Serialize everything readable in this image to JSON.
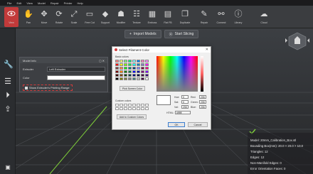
{
  "menubar": [
    "File",
    "Edit",
    "View",
    "Model",
    "Repair",
    "Printer",
    "Help"
  ],
  "toolbar": [
    {
      "label": "View",
      "icon": "eye-icon",
      "active": true
    },
    {
      "label": "Pan",
      "icon": "hand-icon"
    },
    {
      "label": "Move",
      "icon": "move-icon"
    },
    {
      "label": "Rotate",
      "icon": "rotate-icon"
    },
    {
      "label": "Scale",
      "icon": "scale-icon"
    },
    {
      "label": "Free Cut",
      "icon": "cut-icon"
    },
    {
      "label": "Support",
      "icon": "support-icon"
    },
    {
      "label": "Modifier",
      "icon": "modifier-icon"
    },
    {
      "label": "Texture",
      "icon": "texture-icon"
    },
    {
      "label": "Emboss",
      "icon": "emboss-icon"
    },
    {
      "label": "Flat FB",
      "icon": "flat-icon"
    },
    {
      "label": "Duplicate",
      "icon": "duplicate-icon"
    },
    {
      "label": "Repair",
      "icon": "repair-icon"
    },
    {
      "label": "Connect",
      "icon": "connect-icon"
    },
    {
      "label": "Library",
      "icon": "library-icon"
    },
    {
      "label": "Cloud",
      "icon": "cloud-icon"
    }
  ],
  "actions": {
    "import": "Import Models",
    "slice": "Start Slicing"
  },
  "model_info": {
    "title": "Model Info",
    "extruder_label": "Extruder",
    "extruder_value": "Left Extruder",
    "color_label": "Color",
    "color_value": "#ffffff",
    "printing_range_label": "Show Extruder's Printing Range"
  },
  "color_dialog": {
    "title": "Select Filament Color",
    "basic_colors_label": "Basic colors",
    "pick_screen_label": "Pick Screen Color",
    "custom_colors_label": "Custom colors",
    "add_custom_label": "Add to Custom Colors",
    "hue_label": "Hue:",
    "hue_value": "0",
    "sat_label": "Sat:",
    "sat_value": "0",
    "val_label": "Val:",
    "val_value": "255",
    "red_label": "Red:",
    "red_value": "255",
    "green_label": "Green:",
    "green_value": "255",
    "blue_label": "Blue:",
    "blue_value": "255",
    "html_label": "HTML:",
    "html_value": "#ffffff",
    "ok_label": "OK",
    "cancel_label": "Cancel",
    "basic_colors": [
      "#ff8080",
      "#ffff80",
      "#80ff80",
      "#00ff80",
      "#80ffff",
      "#0080ff",
      "#ff80c0",
      "#ff80ff",
      "#ff0000",
      "#ffff00",
      "#80ff00",
      "#00ff40",
      "#00ffff",
      "#0080c0",
      "#8080c0",
      "#ff00ff",
      "#804040",
      "#ff8040",
      "#00ff00",
      "#008080",
      "#004080",
      "#8080ff",
      "#800040",
      "#ff0080",
      "#800000",
      "#ff8000",
      "#008000",
      "#008040",
      "#0000ff",
      "#0000a0",
      "#800080",
      "#8000ff",
      "#400000",
      "#804000",
      "#004000",
      "#004040",
      "#000080",
      "#000040",
      "#400040",
      "#400080",
      "#000000",
      "#808000",
      "#808040",
      "#808080",
      "#408080",
      "#c0c0c0",
      "#400040",
      "#ffffff"
    ]
  },
  "stats": {
    "model": "Model: 20mm_Calibration_Box.stl",
    "bounding_box": "Bounding Box(mm): 20.0 × 20.0 × 10.0",
    "triangles": "Triangles: 12",
    "edges": "Edges: 12",
    "non_manifold": "Non-Manifold Edges: 0",
    "orientation": "Error Orientation Faces: 0"
  }
}
